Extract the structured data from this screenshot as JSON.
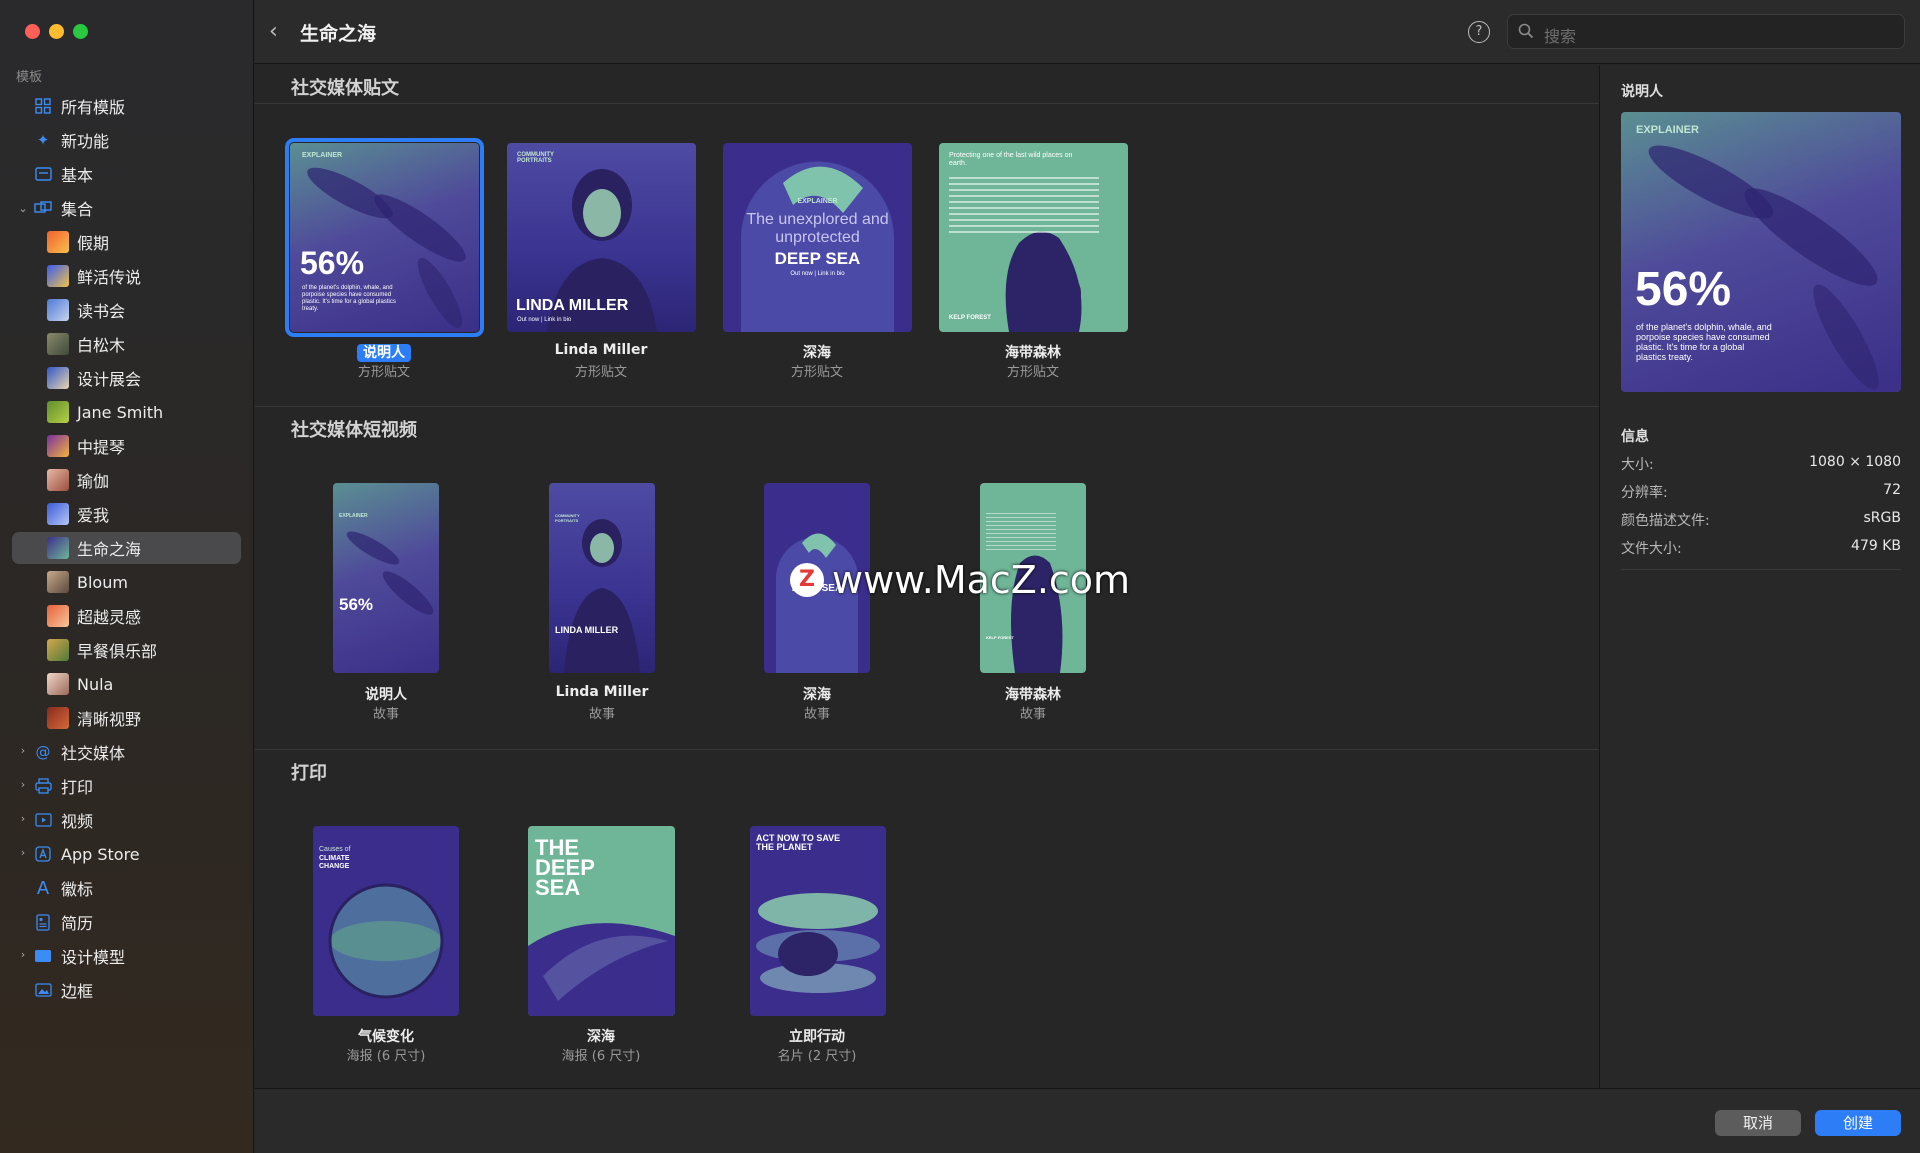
{
  "window": {
    "title": "生命之海"
  },
  "search": {
    "placeholder": "搜索"
  },
  "sidebar": {
    "section_label": "模板",
    "items": [
      {
        "label": "所有模版"
      },
      {
        "label": "新功能"
      },
      {
        "label": "基本"
      },
      {
        "label": "集合"
      },
      {
        "label": "假期"
      },
      {
        "label": "鲜活传说"
      },
      {
        "label": "读书会"
      },
      {
        "label": "白松木"
      },
      {
        "label": "设计展会"
      },
      {
        "label": "Jane Smith"
      },
      {
        "label": "中提琴"
      },
      {
        "label": "瑜伽"
      },
      {
        "label": "爱我"
      },
      {
        "label": "生命之海"
      },
      {
        "label": "Bloum"
      },
      {
        "label": "超越灵感"
      },
      {
        "label": "早餐俱乐部"
      },
      {
        "label": "Nula"
      },
      {
        "label": "清晰视野"
      },
      {
        "label": "社交媒体"
      },
      {
        "label": "打印"
      },
      {
        "label": "视频"
      },
      {
        "label": "App Store"
      },
      {
        "label": "徽标"
      },
      {
        "label": "简历"
      },
      {
        "label": "设计模型"
      },
      {
        "label": "边框"
      }
    ]
  },
  "sections": [
    {
      "title": "社交媒体贴文",
      "cards": [
        {
          "name": "说明人",
          "sub": "方形贴文",
          "t1": "EXPLAINER",
          "t2": "56%",
          "t3": "of the planet's dolphin, whale, and porpoise species have consumed plastic. It's time for a global plastics treaty."
        },
        {
          "name": "Linda Miller",
          "sub": "方形贴文",
          "t1": "COMMUNITY PORTRAITS",
          "t2": "LINDA MILLER",
          "t3": "Out now | Link in bio"
        },
        {
          "name": "深海",
          "sub": "方形贴文",
          "t1": "EXPLAINER",
          "t2": "The unexplored and unprotected",
          "t3": "DEEP SEA",
          "t4": "Out now | Link in bio"
        },
        {
          "name": "海带森林",
          "sub": "方形贴文",
          "t1": "Protecting one of the last wild places on earth.",
          "t2": "KELP FOREST"
        }
      ]
    },
    {
      "title": "社交媒体短视频",
      "cards": [
        {
          "name": "说明人",
          "sub": "故事",
          "t1": "EXPLAINER",
          "t2": "56%"
        },
        {
          "name": "Linda Miller",
          "sub": "故事",
          "t1": "COMMUNITY PORTRAITS",
          "t2": "LINDA MILLER"
        },
        {
          "name": "深海",
          "sub": "故事",
          "t2": "DEEP SEA"
        },
        {
          "name": "海带森林",
          "sub": "故事",
          "t2": "KELP FOREST"
        }
      ]
    },
    {
      "title": "打印",
      "cards": [
        {
          "name": "气候变化",
          "sub": "海报 (6 尺寸)",
          "t1": "Causes of",
          "t2": "CLIMATE CHANGE"
        },
        {
          "name": "深海",
          "sub": "海报 (6 尺寸)",
          "t2": "THE DEEP SEA"
        },
        {
          "name": "立即行动",
          "sub": "名片 (2 尺寸)",
          "t2": "ACT NOW TO SAVE THE PLANET"
        }
      ]
    }
  ],
  "inspector": {
    "title": "说明人",
    "preview": {
      "t1": "EXPLAINER",
      "t2": "56%",
      "t3": "of the planet's dolphin, whale, and porpoise species have consumed plastic. It's time for a global plastics treaty."
    },
    "info_title": "信息",
    "rows": [
      {
        "k": "大小:",
        "v": "1080 × 1080"
      },
      {
        "k": "分辨率:",
        "v": "72"
      },
      {
        "k": "颜色描述文件:",
        "v": "sRGB"
      },
      {
        "k": "文件大小:",
        "v": "479 KB"
      }
    ]
  },
  "footer": {
    "cancel": "取消",
    "create": "创建"
  },
  "watermark": {
    "logo": "Z",
    "text": "www.MacZ.com"
  },
  "colors": {
    "accent": "#2c7df6",
    "purple": "#3c2f8a",
    "mint": "#6fb598",
    "sidebar_bg": "#2a2a2d",
    "main_bg": "#262626"
  }
}
